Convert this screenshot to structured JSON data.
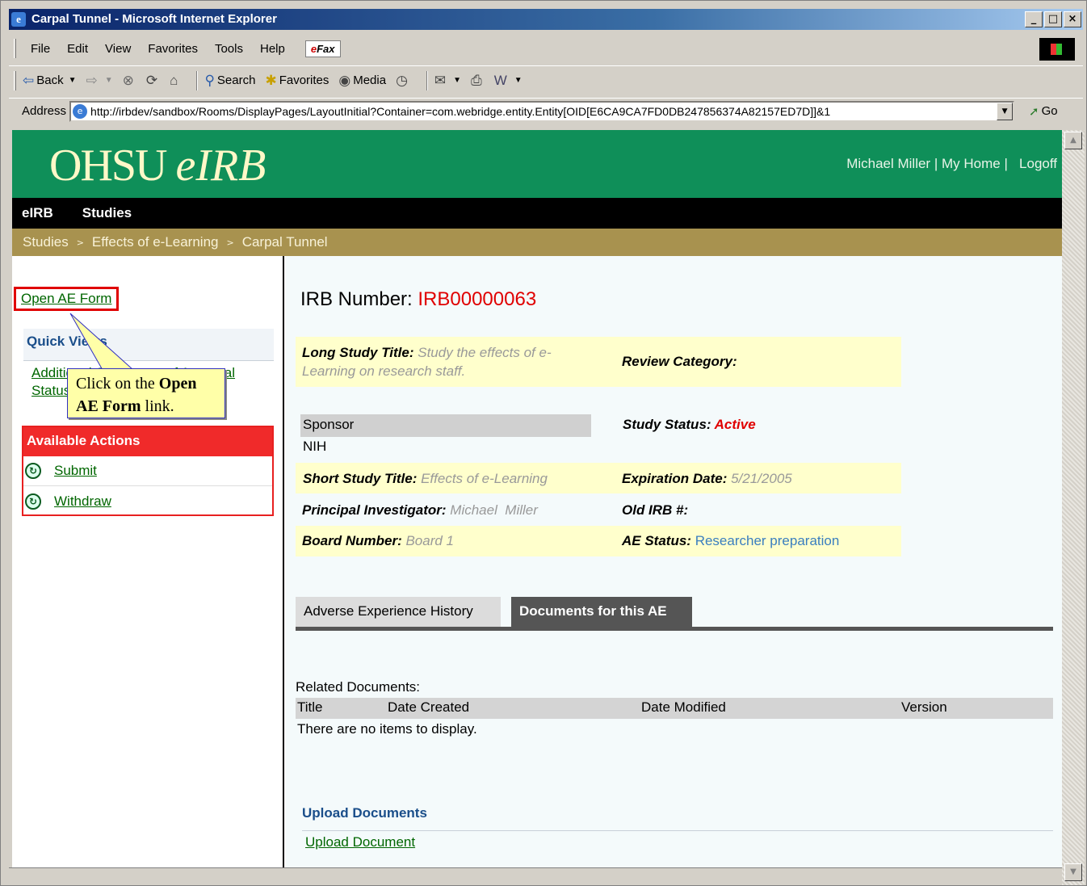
{
  "window": {
    "title": "Carpal Tunnel - Microsoft Internet Explorer",
    "buttons": [
      "_",
      "□",
      "×"
    ]
  },
  "menu": [
    "File",
    "Edit",
    "View",
    "Favorites",
    "Tools",
    "Help"
  ],
  "efax": {
    "prefix": "e",
    "label": "Fax"
  },
  "toolbar": {
    "back": "Back",
    "search": "Search",
    "favorites": "Favorites",
    "media": "Media"
  },
  "address": {
    "label": "Address",
    "url": "http://irbdev/sandbox/Rooms/DisplayPages/LayoutInitial?Container=com.webridge.entity.Entity[OID[E6CA9CA7FD0DB247856374A82157ED7D]]&1",
    "go": "Go"
  },
  "header": {
    "logo_main": "OHSU ",
    "logo_italic": "eIRB",
    "user": "Michael Miller",
    "sep": " | ",
    "my_home": "My Home",
    "sep2": " |   ",
    "logoff": "Logoff"
  },
  "nav": [
    "eIRB",
    "Studies"
  ],
  "breadcrumb": [
    "Studies",
    "Effects of e-Learning",
    "Carpal Tunnel"
  ],
  "breadcrumb_sep": ">",
  "left": {
    "open_ae_form": "Open AE Form",
    "quick_views": "Quick Views",
    "quick_links": [
      "Additional Staff Letter of Approval",
      "Status"
    ],
    "available_actions": "Available Actions",
    "actions": [
      "Submit",
      "Withdraw"
    ]
  },
  "callout": {
    "pre": "Click on the ",
    "bold": "Open AE Form",
    "post": " link."
  },
  "study": {
    "irb_label": "IRB Number: ",
    "irb_value": "IRB00000063",
    "long_title_label": "Long Study Title:",
    "long_title_value": "Study the effects of e-Learning on research staff.",
    "review_category_label": "Review Category:",
    "sponsor_label": "Sponsor",
    "sponsor_value": "NIH",
    "study_status_label": "Study Status:",
    "study_status_value": "Active",
    "short_title_label": "Short Study Title:",
    "short_title_value": "Effects of e-Learning",
    "expiration_label": "Expiration Date:",
    "expiration_value": "5/21/2005",
    "pi_label": "Principal Investigator:",
    "pi_value": "Michael  Miller",
    "old_irb_label": "Old IRB #:",
    "board_label": "Board Number:",
    "board_value": "Board 1",
    "ae_status_label": "AE Status:",
    "ae_status_value": "Researcher preparation"
  },
  "tabs": [
    "Adverse Experience History",
    "Documents for this AE"
  ],
  "documents": {
    "related_label": "Related Documents:",
    "columns": [
      "Title",
      "Date Created",
      "Date Modified",
      "Version"
    ],
    "empty_text": "There are no items to display.",
    "upload_heading": "Upload Documents",
    "upload_link": "Upload Document"
  }
}
